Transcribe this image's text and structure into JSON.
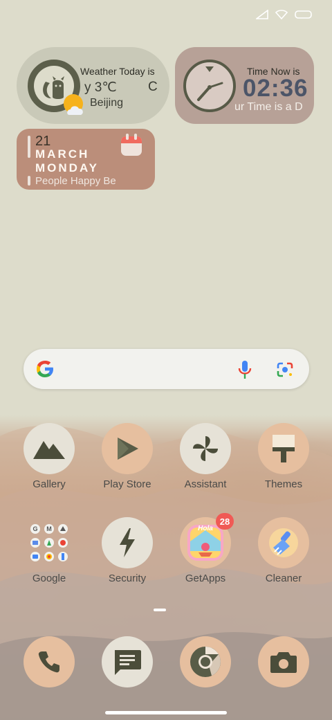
{
  "status_bar": {
    "icons": [
      "signal-icon",
      "wifi-icon",
      "battery-icon"
    ]
  },
  "weather_widget": {
    "title": "Weather Today is",
    "temp_text": "y  3℃",
    "unit_text": "C",
    "city": "Beijing"
  },
  "time_widget": {
    "title": "Time Now is",
    "time": "02:36",
    "subtitle": "ur Time is a D"
  },
  "date_widget": {
    "day": "21",
    "month": "MARCH",
    "weekday": "MONDAY",
    "marquee": "People Happy        Be"
  },
  "search": {
    "icons": [
      "google-g-icon",
      "microphone-icon",
      "lens-camera-icon"
    ]
  },
  "apps": [
    {
      "label": "Gallery"
    },
    {
      "label": "Play Store"
    },
    {
      "label": "Assistant"
    },
    {
      "label": "Themes"
    },
    {
      "label": "Google"
    },
    {
      "label": "Security"
    },
    {
      "label": "GetApps",
      "badge": "28"
    },
    {
      "label": "Cleaner"
    }
  ],
  "dock": {
    "icons": [
      "phone-icon",
      "messages-icon",
      "chrome-icon",
      "camera-icon"
    ]
  },
  "colors": {
    "background": "#dddccb",
    "widget_weather": "#c9c9b8",
    "widget_time": "#b7a197",
    "widget_date": "#bb8e7a",
    "badge": "#f05a55"
  }
}
